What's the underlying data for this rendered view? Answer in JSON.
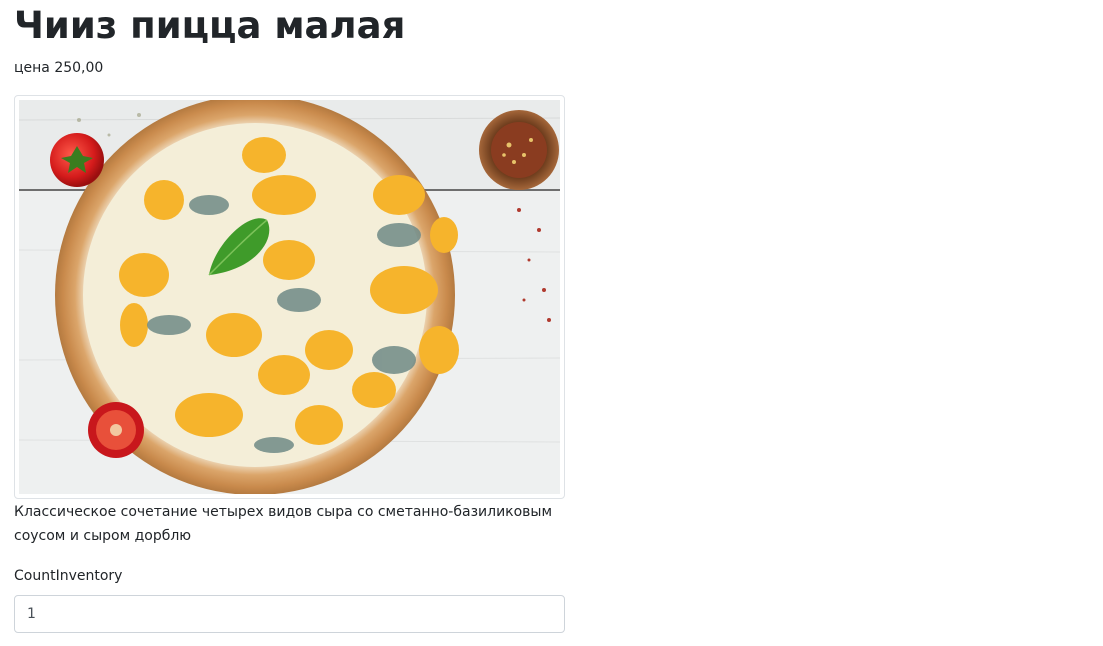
{
  "product": {
    "title": "Чииз пицца малая",
    "price": "цена 250,00",
    "image_alt": "pizza-photo",
    "description": "Классическое сочетание четырех видов сыра со сметанно-базиликовым соусом и сыром дорблю"
  },
  "form": {
    "count_label": "CountInventory",
    "count_value": "1"
  }
}
